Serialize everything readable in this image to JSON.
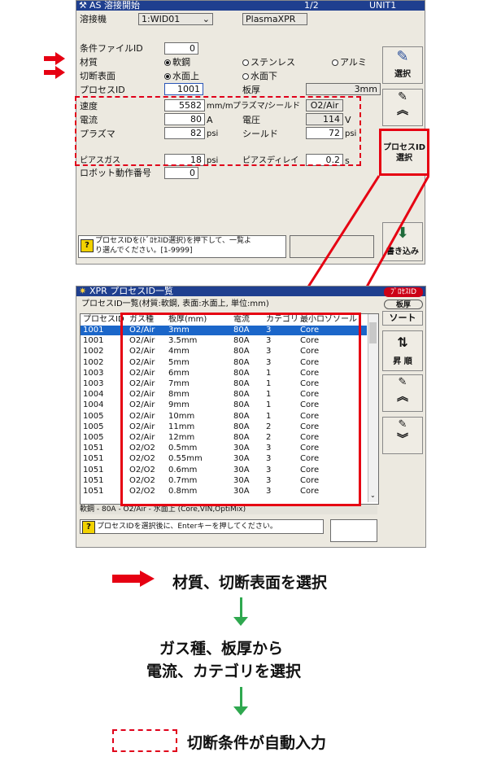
{
  "win1": {
    "title": "AS 溶接開始",
    "page": "1/2",
    "unit": "UNIT1",
    "welder_label": "溶接機",
    "welder_value": "1:WID01",
    "welder_type": "PlasmaXPR",
    "cond_file_label": "条件ファイルID",
    "cond_file_value": "0",
    "material_label": "材質",
    "material_opts": [
      "軟鋼",
      "ステンレス",
      "アルミ"
    ],
    "surface_label": "切断表面",
    "surface_opts": [
      "水面上",
      "水面下"
    ],
    "process_label": "プロセスID",
    "process_value": "1001",
    "thickness_label": "板厚",
    "thickness_value": "3mm",
    "speed_label": "速度",
    "speed_value": "5582",
    "speed_unit": "mm/m",
    "plasma_shield_label": "プラズマ/シールド",
    "plasma_shield_value": "O2/Air",
    "current_label": "電流",
    "current_value": "80",
    "current_unit": "A",
    "voltage_label": "電圧",
    "voltage_value": "114",
    "voltage_unit": "V",
    "plasma_label": "プラズマ",
    "plasma_value": "82",
    "plasma_unit": "psi",
    "shield_label": "シールド",
    "shield_value": "72",
    "shield_unit": "psi",
    "pierce_gas_label": "ピアスガス",
    "pierce_gas_value": "18",
    "pierce_gas_unit": "psi",
    "pierce_delay_label": "ピアスディレイ",
    "pierce_delay_value": "0.2",
    "pierce_delay_unit": "s",
    "robot_label": "ロボット動作番号",
    "robot_value": "0",
    "status_text_1": "プロセスIDを(ﾄﾞﾛｾｽID選択)を押下して、一覧よ",
    "status_text_2": "り選んでください。[1-9999]",
    "side_select": "選択",
    "side_write": "書き込み",
    "callout_line1": "プロセスID",
    "callout_line2": "選択"
  },
  "win2": {
    "title": "XPR プロセスID一覧",
    "subtitle": "プロセスID一覧(材質:軟鋼, 表面:水面上, 単位:mm)",
    "headers": [
      "プロセスID",
      "ガス種",
      "板厚(mm)",
      "電流",
      "カテゴリ",
      "最小ロゾソール"
    ],
    "rows": [
      [
        "1001",
        "O2/Air",
        "3mm",
        "80A",
        "3",
        "Core"
      ],
      [
        "1001",
        "O2/Air",
        "3.5mm",
        "80A",
        "3",
        "Core"
      ],
      [
        "1002",
        "O2/Air",
        "4mm",
        "80A",
        "3",
        "Core"
      ],
      [
        "1002",
        "O2/Air",
        "5mm",
        "80A",
        "3",
        "Core"
      ],
      [
        "1003",
        "O2/Air",
        "6mm",
        "80A",
        "1",
        "Core"
      ],
      [
        "1003",
        "O2/Air",
        "7mm",
        "80A",
        "1",
        "Core"
      ],
      [
        "1004",
        "O2/Air",
        "8mm",
        "80A",
        "1",
        "Core"
      ],
      [
        "1004",
        "O2/Air",
        "9mm",
        "80A",
        "1",
        "Core"
      ],
      [
        "1005",
        "O2/Air",
        "10mm",
        "80A",
        "1",
        "Core"
      ],
      [
        "1005",
        "O2/Air",
        "11mm",
        "80A",
        "2",
        "Core"
      ],
      [
        "1005",
        "O2/Air",
        "12mm",
        "80A",
        "2",
        "Core"
      ],
      [
        "1051",
        "O2/O2",
        "0.5mm",
        "30A",
        "3",
        "Core"
      ],
      [
        "1051",
        "O2/O2",
        "0.55mm",
        "30A",
        "3",
        "Core"
      ],
      [
        "1051",
        "O2/O2",
        "0.6mm",
        "30A",
        "3",
        "Core"
      ],
      [
        "1051",
        "O2/O2",
        "0.7mm",
        "30A",
        "3",
        "Core"
      ],
      [
        "1051",
        "O2/O2",
        "0.8mm",
        "30A",
        "3",
        "Core"
      ]
    ],
    "footer_text": "軟鋼 - 80A - O2/Air - 水面上 (Core,VIN,OptiMix)",
    "status_text": "プロセスIDを選択後に、Enterキーを押してください。",
    "side_badge": "ﾌﾟﾛｾｽID",
    "side_tab": "板厚",
    "side_sort": "ソート",
    "side_asc": "昇 順"
  },
  "flow": {
    "step1": "材質、切断表面を選択",
    "step2_line1": "ガス種、板厚から",
    "step2_line2": "電流、カテゴリを選択",
    "step3": "切断条件が自動入力"
  },
  "colors": {
    "highlight_red": "#e60012",
    "flow_green": "#2fa84f",
    "titlebar_blue": "#1f3f8f",
    "selection_blue": "#1b66c9"
  }
}
